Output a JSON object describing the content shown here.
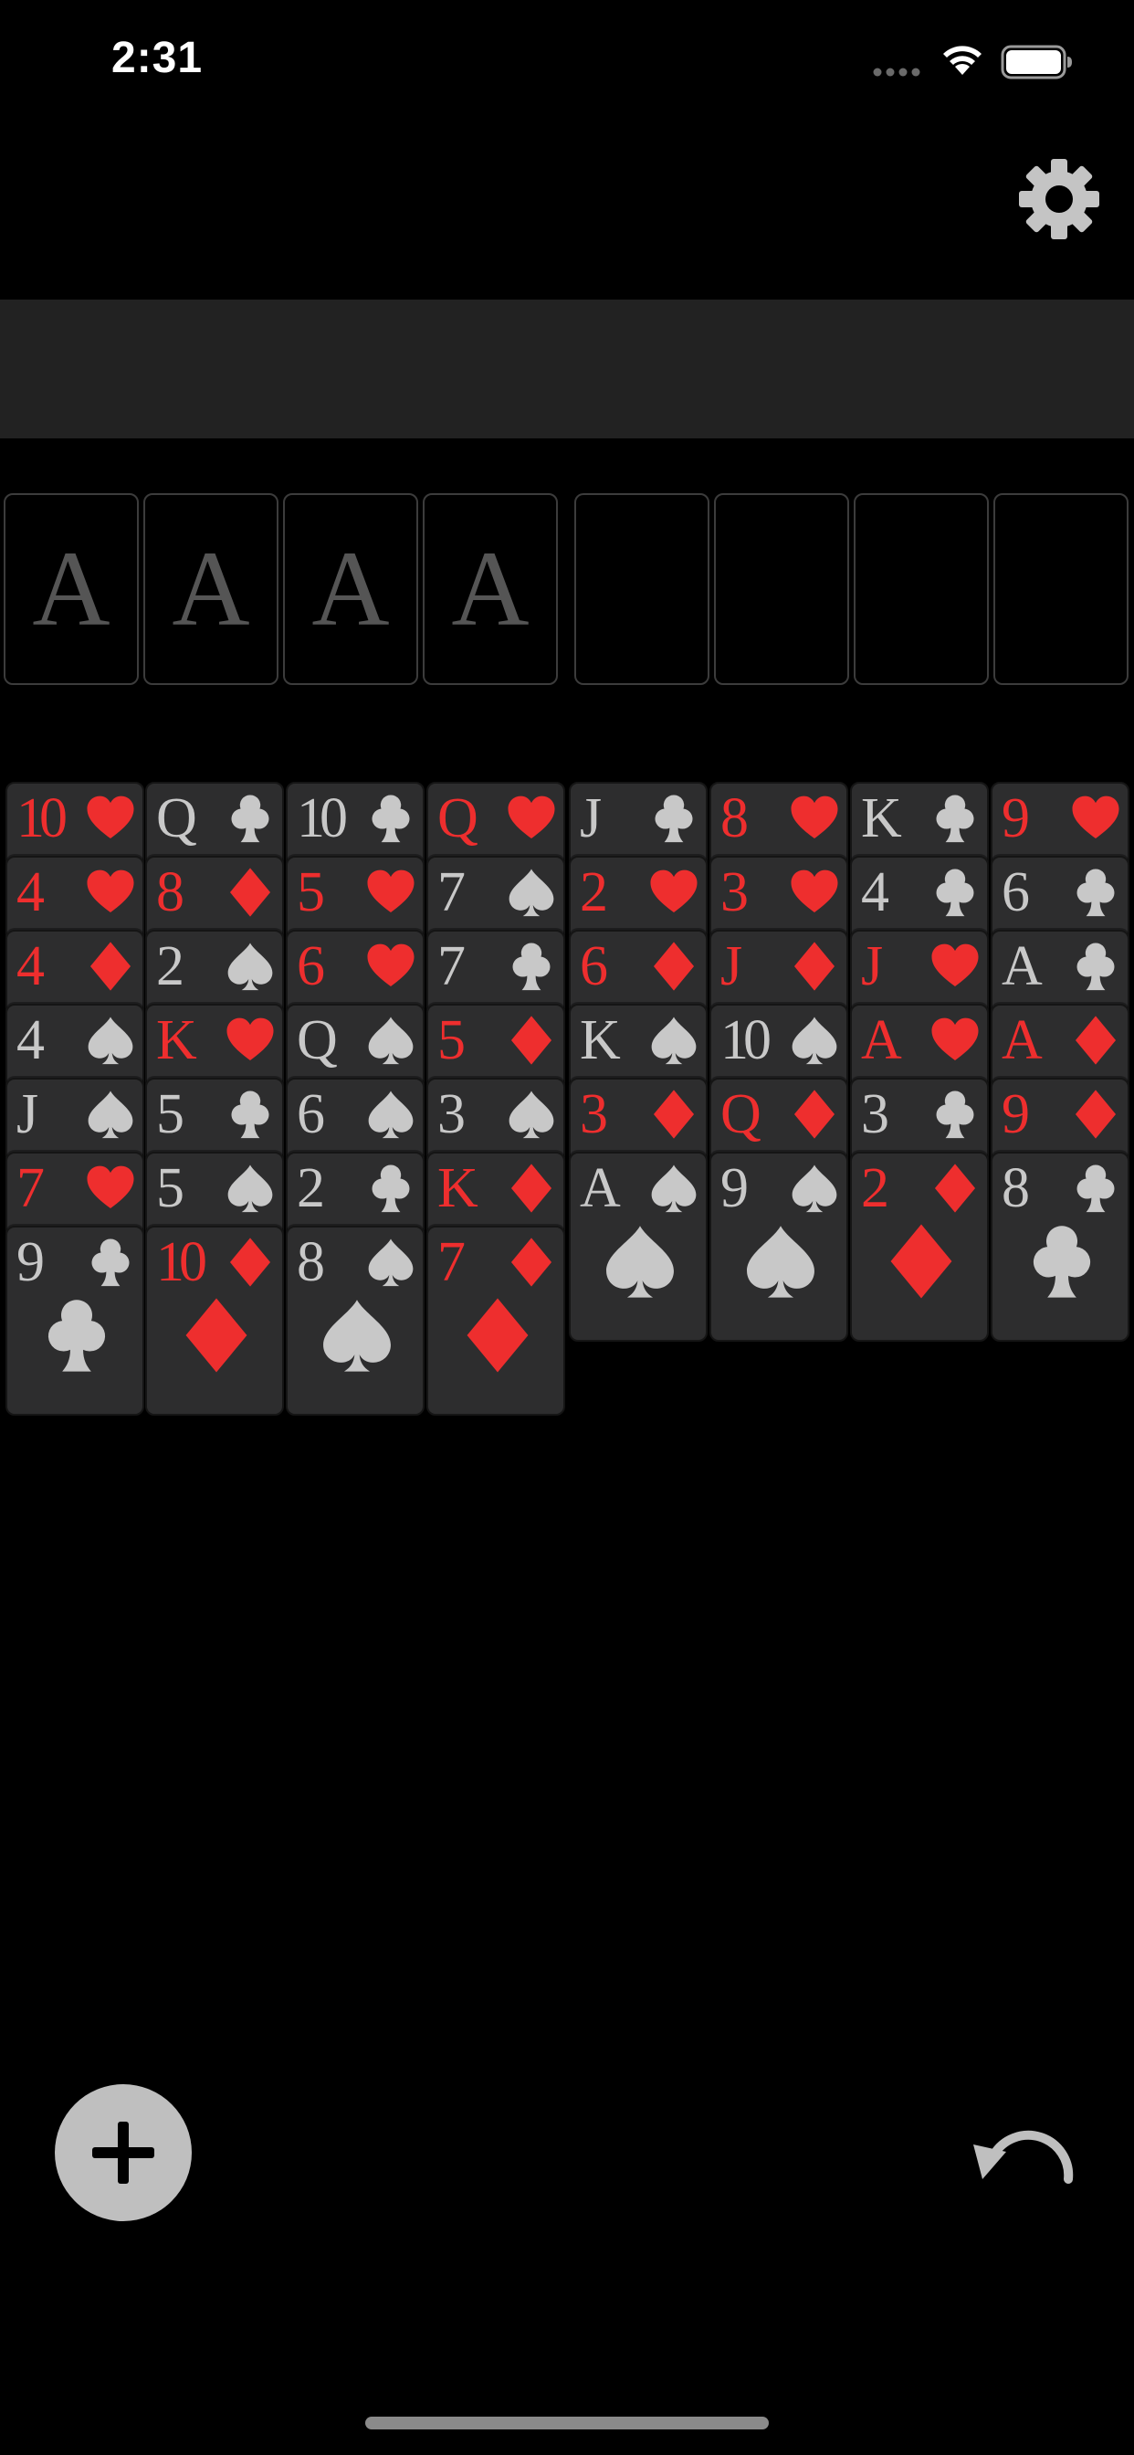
{
  "status_bar": {
    "time": "2:31"
  },
  "colors": {
    "background": "#000000",
    "banner": "#222222",
    "card_face": "#2d2d2e",
    "red_suit": "#ee2e2e",
    "black_suit": "#c8c8c8",
    "slot_border": "#3c3c3c",
    "slot_label": "#555555",
    "button": "#bfbfbf"
  },
  "icons": {
    "settings": "gear-icon",
    "add": "plus-icon",
    "undo": "undo-icon"
  },
  "foundations": [
    {
      "label": "A"
    },
    {
      "label": "A"
    },
    {
      "label": "A"
    },
    {
      "label": "A"
    }
  ],
  "free_cells": [
    {
      "label": ""
    },
    {
      "label": ""
    },
    {
      "label": ""
    },
    {
      "label": ""
    }
  ],
  "tableau": [
    [
      {
        "rank": "10",
        "suit": "hearts"
      },
      {
        "rank": "4",
        "suit": "hearts"
      },
      {
        "rank": "4",
        "suit": "diamonds"
      },
      {
        "rank": "4",
        "suit": "spades"
      },
      {
        "rank": "J",
        "suit": "spades"
      },
      {
        "rank": "7",
        "suit": "hearts"
      },
      {
        "rank": "9",
        "suit": "clubs"
      }
    ],
    [
      {
        "rank": "Q",
        "suit": "clubs"
      },
      {
        "rank": "8",
        "suit": "diamonds"
      },
      {
        "rank": "2",
        "suit": "spades"
      },
      {
        "rank": "K",
        "suit": "hearts"
      },
      {
        "rank": "5",
        "suit": "clubs"
      },
      {
        "rank": "5",
        "suit": "spades"
      },
      {
        "rank": "10",
        "suit": "diamonds"
      }
    ],
    [
      {
        "rank": "10",
        "suit": "clubs"
      },
      {
        "rank": "5",
        "suit": "hearts"
      },
      {
        "rank": "6",
        "suit": "hearts"
      },
      {
        "rank": "Q",
        "suit": "spades"
      },
      {
        "rank": "6",
        "suit": "spades"
      },
      {
        "rank": "2",
        "suit": "clubs"
      },
      {
        "rank": "8",
        "suit": "spades"
      }
    ],
    [
      {
        "rank": "Q",
        "suit": "hearts"
      },
      {
        "rank": "7",
        "suit": "spades"
      },
      {
        "rank": "7",
        "suit": "clubs"
      },
      {
        "rank": "5",
        "suit": "diamonds"
      },
      {
        "rank": "3",
        "suit": "spades"
      },
      {
        "rank": "K",
        "suit": "diamonds"
      },
      {
        "rank": "7",
        "suit": "diamonds"
      }
    ],
    [
      {
        "rank": "J",
        "suit": "clubs"
      },
      {
        "rank": "2",
        "suit": "hearts"
      },
      {
        "rank": "6",
        "suit": "diamonds"
      },
      {
        "rank": "K",
        "suit": "spades"
      },
      {
        "rank": "3",
        "suit": "diamonds"
      },
      {
        "rank": "A",
        "suit": "spades"
      }
    ],
    [
      {
        "rank": "8",
        "suit": "hearts"
      },
      {
        "rank": "3",
        "suit": "hearts"
      },
      {
        "rank": "J",
        "suit": "diamonds"
      },
      {
        "rank": "10",
        "suit": "spades"
      },
      {
        "rank": "Q",
        "suit": "diamonds"
      },
      {
        "rank": "9",
        "suit": "spades"
      }
    ],
    [
      {
        "rank": "K",
        "suit": "clubs"
      },
      {
        "rank": "4",
        "suit": "clubs"
      },
      {
        "rank": "J",
        "suit": "hearts"
      },
      {
        "rank": "A",
        "suit": "hearts"
      },
      {
        "rank": "3",
        "suit": "clubs"
      },
      {
        "rank": "2",
        "suit": "diamonds"
      }
    ],
    [
      {
        "rank": "9",
        "suit": "hearts"
      },
      {
        "rank": "6",
        "suit": "clubs"
      },
      {
        "rank": "A",
        "suit": "clubs"
      },
      {
        "rank": "A",
        "suit": "diamonds"
      },
      {
        "rank": "9",
        "suit": "diamonds"
      },
      {
        "rank": "8",
        "suit": "clubs"
      }
    ]
  ]
}
